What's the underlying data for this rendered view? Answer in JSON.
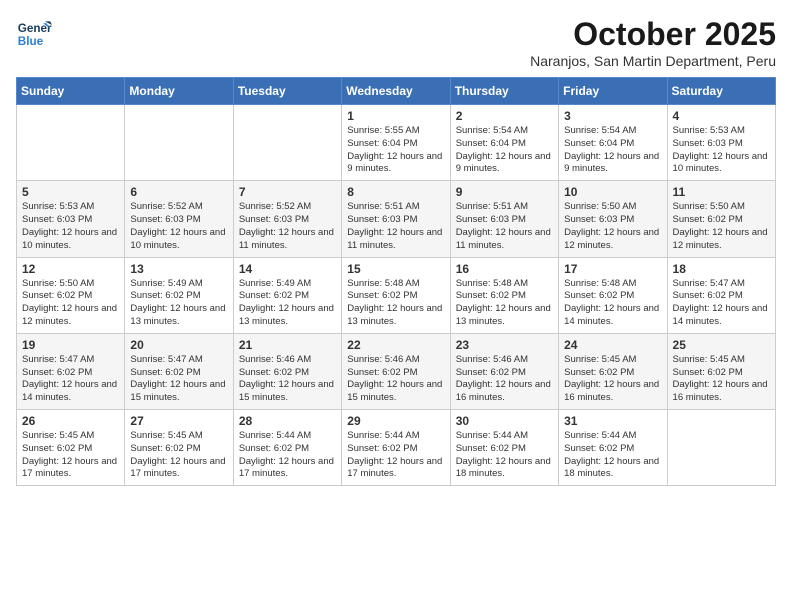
{
  "header": {
    "logo_line1": "General",
    "logo_line2": "Blue",
    "month": "October 2025",
    "location": "Naranjos, San Martin Department, Peru"
  },
  "weekdays": [
    "Sunday",
    "Monday",
    "Tuesday",
    "Wednesday",
    "Thursday",
    "Friday",
    "Saturday"
  ],
  "weeks": [
    [
      {
        "day": "",
        "text": ""
      },
      {
        "day": "",
        "text": ""
      },
      {
        "day": "",
        "text": ""
      },
      {
        "day": "1",
        "text": "Sunrise: 5:55 AM\nSunset: 6:04 PM\nDaylight: 12 hours and 9 minutes."
      },
      {
        "day": "2",
        "text": "Sunrise: 5:54 AM\nSunset: 6:04 PM\nDaylight: 12 hours and 9 minutes."
      },
      {
        "day": "3",
        "text": "Sunrise: 5:54 AM\nSunset: 6:04 PM\nDaylight: 12 hours and 9 minutes."
      },
      {
        "day": "4",
        "text": "Sunrise: 5:53 AM\nSunset: 6:03 PM\nDaylight: 12 hours and 10 minutes."
      }
    ],
    [
      {
        "day": "5",
        "text": "Sunrise: 5:53 AM\nSunset: 6:03 PM\nDaylight: 12 hours and 10 minutes."
      },
      {
        "day": "6",
        "text": "Sunrise: 5:52 AM\nSunset: 6:03 PM\nDaylight: 12 hours and 10 minutes."
      },
      {
        "day": "7",
        "text": "Sunrise: 5:52 AM\nSunset: 6:03 PM\nDaylight: 12 hours and 11 minutes."
      },
      {
        "day": "8",
        "text": "Sunrise: 5:51 AM\nSunset: 6:03 PM\nDaylight: 12 hours and 11 minutes."
      },
      {
        "day": "9",
        "text": "Sunrise: 5:51 AM\nSunset: 6:03 PM\nDaylight: 12 hours and 11 minutes."
      },
      {
        "day": "10",
        "text": "Sunrise: 5:50 AM\nSunset: 6:03 PM\nDaylight: 12 hours and 12 minutes."
      },
      {
        "day": "11",
        "text": "Sunrise: 5:50 AM\nSunset: 6:02 PM\nDaylight: 12 hours and 12 minutes."
      }
    ],
    [
      {
        "day": "12",
        "text": "Sunrise: 5:50 AM\nSunset: 6:02 PM\nDaylight: 12 hours and 12 minutes."
      },
      {
        "day": "13",
        "text": "Sunrise: 5:49 AM\nSunset: 6:02 PM\nDaylight: 12 hours and 13 minutes."
      },
      {
        "day": "14",
        "text": "Sunrise: 5:49 AM\nSunset: 6:02 PM\nDaylight: 12 hours and 13 minutes."
      },
      {
        "day": "15",
        "text": "Sunrise: 5:48 AM\nSunset: 6:02 PM\nDaylight: 12 hours and 13 minutes."
      },
      {
        "day": "16",
        "text": "Sunrise: 5:48 AM\nSunset: 6:02 PM\nDaylight: 12 hours and 13 minutes."
      },
      {
        "day": "17",
        "text": "Sunrise: 5:48 AM\nSunset: 6:02 PM\nDaylight: 12 hours and 14 minutes."
      },
      {
        "day": "18",
        "text": "Sunrise: 5:47 AM\nSunset: 6:02 PM\nDaylight: 12 hours and 14 minutes."
      }
    ],
    [
      {
        "day": "19",
        "text": "Sunrise: 5:47 AM\nSunset: 6:02 PM\nDaylight: 12 hours and 14 minutes."
      },
      {
        "day": "20",
        "text": "Sunrise: 5:47 AM\nSunset: 6:02 PM\nDaylight: 12 hours and 15 minutes."
      },
      {
        "day": "21",
        "text": "Sunrise: 5:46 AM\nSunset: 6:02 PM\nDaylight: 12 hours and 15 minutes."
      },
      {
        "day": "22",
        "text": "Sunrise: 5:46 AM\nSunset: 6:02 PM\nDaylight: 12 hours and 15 minutes."
      },
      {
        "day": "23",
        "text": "Sunrise: 5:46 AM\nSunset: 6:02 PM\nDaylight: 12 hours and 16 minutes."
      },
      {
        "day": "24",
        "text": "Sunrise: 5:45 AM\nSunset: 6:02 PM\nDaylight: 12 hours and 16 minutes."
      },
      {
        "day": "25",
        "text": "Sunrise: 5:45 AM\nSunset: 6:02 PM\nDaylight: 12 hours and 16 minutes."
      }
    ],
    [
      {
        "day": "26",
        "text": "Sunrise: 5:45 AM\nSunset: 6:02 PM\nDaylight: 12 hours and 17 minutes."
      },
      {
        "day": "27",
        "text": "Sunrise: 5:45 AM\nSunset: 6:02 PM\nDaylight: 12 hours and 17 minutes."
      },
      {
        "day": "28",
        "text": "Sunrise: 5:44 AM\nSunset: 6:02 PM\nDaylight: 12 hours and 17 minutes."
      },
      {
        "day": "29",
        "text": "Sunrise: 5:44 AM\nSunset: 6:02 PM\nDaylight: 12 hours and 17 minutes."
      },
      {
        "day": "30",
        "text": "Sunrise: 5:44 AM\nSunset: 6:02 PM\nDaylight: 12 hours and 18 minutes."
      },
      {
        "day": "31",
        "text": "Sunrise: 5:44 AM\nSunset: 6:02 PM\nDaylight: 12 hours and 18 minutes."
      },
      {
        "day": "",
        "text": ""
      }
    ]
  ]
}
